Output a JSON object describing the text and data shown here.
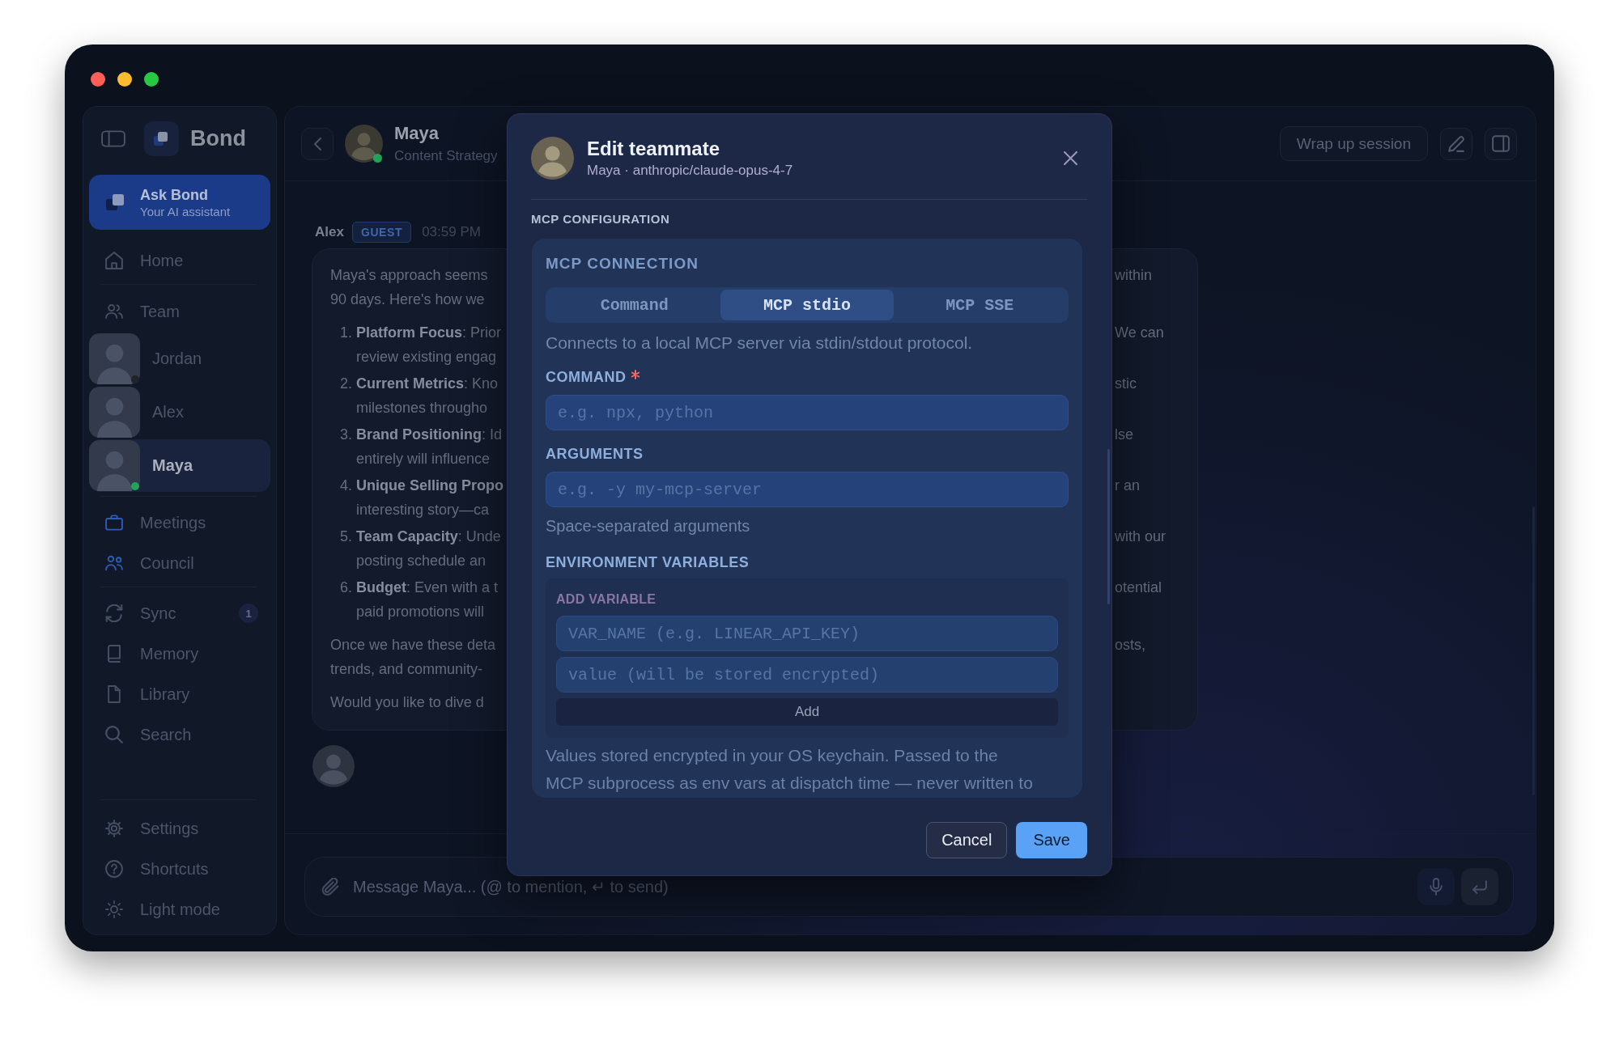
{
  "sidebar": {
    "brand": "Bond",
    "assistant": {
      "title": "Ask Bond",
      "subtitle": "Your AI assistant"
    },
    "sections": [
      {
        "kind": "nav",
        "items": [
          {
            "label": "Home",
            "selected": false
          }
        ]
      },
      {
        "kind": "team",
        "items": [
          {
            "label": "Team",
            "selected": false
          }
        ],
        "members": [
          {
            "name": "Jordan",
            "selected": false,
            "color": "#1e232e"
          },
          {
            "name": "Alex",
            "selected": false
          },
          {
            "name": "Maya",
            "selected": true,
            "color": "#22a35a"
          }
        ]
      },
      {
        "kind": "nav",
        "accent": true,
        "items": [
          {
            "label": "Meetings",
            "selected": false
          },
          {
            "label": "Council",
            "selected": false
          }
        ]
      },
      {
        "kind": "nav",
        "items": [
          {
            "label": "Sync",
            "selected": false,
            "badge": "1"
          },
          {
            "label": "Memory",
            "selected": false
          },
          {
            "label": "Library",
            "selected": false
          },
          {
            "label": "Search",
            "selected": false
          }
        ]
      },
      {
        "kind": "footer",
        "items": [
          {
            "label": "Settings",
            "selected": false
          },
          {
            "label": "Shortcuts",
            "selected": false
          },
          {
            "label": "Light mode",
            "selected": false
          }
        ]
      }
    ]
  },
  "chat_header": {
    "name": "Maya",
    "role": "Content Strategy",
    "online": true,
    "wrap_up_button": "Wrap up session"
  },
  "message": {
    "sender": "Alex",
    "badge": "GUEST",
    "time": "03:59 PM",
    "blocks": [
      {
        "kind": "paragraph",
        "lines": [
          {
            "text": "Maya's approach seems",
            "right_text": "within"
          },
          {
            "text": "90 days. Here's how we"
          }
        ]
      },
      {
        "kind": "list",
        "items": [
          {
            "number": "1.",
            "lines": [
              {
                "text": "**Platform Focus**: Prior",
                "right_text": "We can"
              },
              {
                "text": "review existing engag"
              }
            ]
          },
          {
            "number": "2.",
            "lines": [
              {
                "text": "**Current Metrics**: Kno",
                "right_text": "stic"
              },
              {
                "text": "milestones througho"
              }
            ]
          },
          {
            "number": "3.",
            "lines": [
              {
                "text": "**Brand Positioning**: Id",
                "right_text": "lse"
              },
              {
                "text": "entirely will influence"
              }
            ]
          },
          {
            "number": "4.",
            "lines": [
              {
                "text": "**Unique Selling Propo**",
                "right_text": "r an"
              },
              {
                "text": "interesting story—ca"
              }
            ]
          },
          {
            "number": "5.",
            "lines": [
              {
                "text": "**Team Capacity**: Unde",
                "right_text": "with our"
              },
              {
                "text": "posting schedule an"
              }
            ]
          },
          {
            "number": "6.",
            "lines": [
              {
                "text": "**Budget**: Even with a t",
                "right_text": "otential"
              },
              {
                "text": "paid promotions will"
              }
            ]
          }
        ]
      },
      {
        "kind": "paragraph",
        "lines": [
          {
            "text": "Once we have these deta",
            "right_text": "osts,"
          },
          {
            "text": "trends, and community-"
          }
        ]
      },
      {
        "kind": "paragraph",
        "lines": [
          {
            "text": "Would you like to dive d"
          }
        ]
      }
    ]
  },
  "composer": {
    "placeholder": "Message Maya... (@ to mention, ↵ to send)"
  },
  "dialog": {
    "title": "Edit teammate",
    "subtitle": "Maya · anthropic/claude-opus-4-7",
    "section": "MCP CONFIGURATION",
    "connection": {
      "heading": "MCP CONNECTION",
      "tabs": [
        {
          "label": "Command",
          "selected": false
        },
        {
          "label": "MCP stdio",
          "selected": true
        },
        {
          "label": "MCP SSE",
          "selected": false
        }
      ],
      "description": "Connects to a local MCP server via stdin/stdout protocol.",
      "fields": [
        {
          "label": "COMMAND",
          "required": true,
          "placeholder": "e.g. npx, python"
        },
        {
          "label": "ARGUMENTS",
          "required": false,
          "placeholder": "e.g. -y my-mcp-server",
          "hint": "Space-separated arguments"
        }
      ],
      "env": {
        "heading": "ENVIRONMENT VARIABLES",
        "subheading": "ADD VARIABLE",
        "fields": [
          {
            "placeholder": "VAR_NAME (e.g. LINEAR_API_KEY)"
          },
          {
            "placeholder": "value (will be stored encrypted)"
          }
        ],
        "add_button": "Add",
        "note_lines": [
          "Values stored encrypted in your OS keychain. Passed to the",
          "MCP subprocess as env vars at dispatch time — never written to"
        ]
      }
    },
    "buttons": [
      {
        "label": "Cancel",
        "kind": "secondary"
      },
      {
        "label": "Save",
        "kind": "primary"
      }
    ]
  }
}
